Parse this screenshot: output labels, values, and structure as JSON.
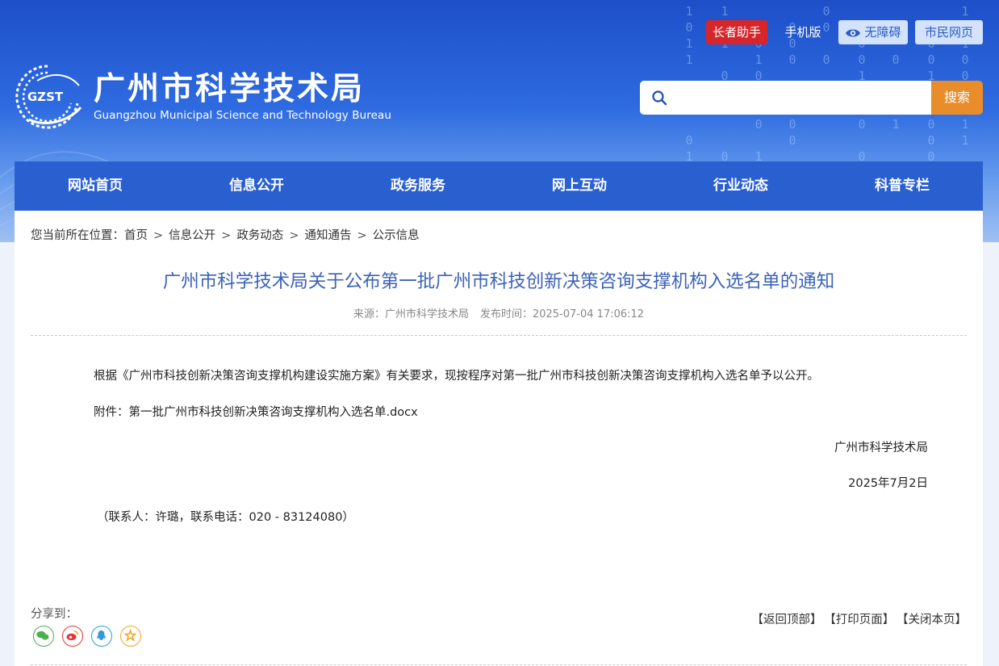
{
  "header": {
    "site_title": "广州市科学技术局",
    "site_subtitle": "Guangzhou Municipal Science and Technology Bureau",
    "logo_text": "GZST",
    "top_links": {
      "elder": "长者助手",
      "mobile": "手机版",
      "accessibility": "无障碍",
      "citizen": "市民网页"
    },
    "search": {
      "placeholder": "",
      "button_label": "搜索"
    }
  },
  "nav": {
    "items": [
      {
        "label": "网站首页"
      },
      {
        "label": "信息公开"
      },
      {
        "label": "政务服务"
      },
      {
        "label": "网上互动"
      },
      {
        "label": "行业动态"
      },
      {
        "label": "科普专栏"
      }
    ]
  },
  "breadcrumb": {
    "prefix": "您当前所在位置：",
    "items": [
      "首页",
      "信息公开",
      "政务动态",
      "通知通告",
      "公示信息"
    ],
    "separator": ">"
  },
  "article": {
    "title": "广州市科学技术局关于公布第一批广州市科技创新决策咨询支撑机构入选名单的通知",
    "source_label": "来源：",
    "source": "广州市科学技术局",
    "time_label": "发布时间：",
    "time": "2025-07-04 17:06:12",
    "body": "根据《广州市科技创新决策咨询支撑机构建设实施方案》有关要求，现按程序对第一批广州市科技创新决策咨询支撑机构入选名单予以公开。",
    "attachment_label": "附件：",
    "attachment_name": "第一批广州市科技创新决策咨询支撑机构入选名单.docx",
    "signature": "广州市科学技术局",
    "date": "2025年7月2日",
    "contact": "（联系人：许璐，联系电话：020 - 83124080）"
  },
  "share": {
    "label": "分享到：",
    "icons": [
      "wechat-icon",
      "weibo-icon",
      "qq-icon",
      "qzone-icon"
    ]
  },
  "footer_links": {
    "back_top": "【返回顶部】",
    "print": "【打印页面】",
    "close": "【关闭本页】"
  },
  "colors": {
    "nav_bg": "#2a5fd0",
    "title_blue": "#3d63b8",
    "search_button": "#e98d2a",
    "elder_button": "#d6262a"
  }
}
